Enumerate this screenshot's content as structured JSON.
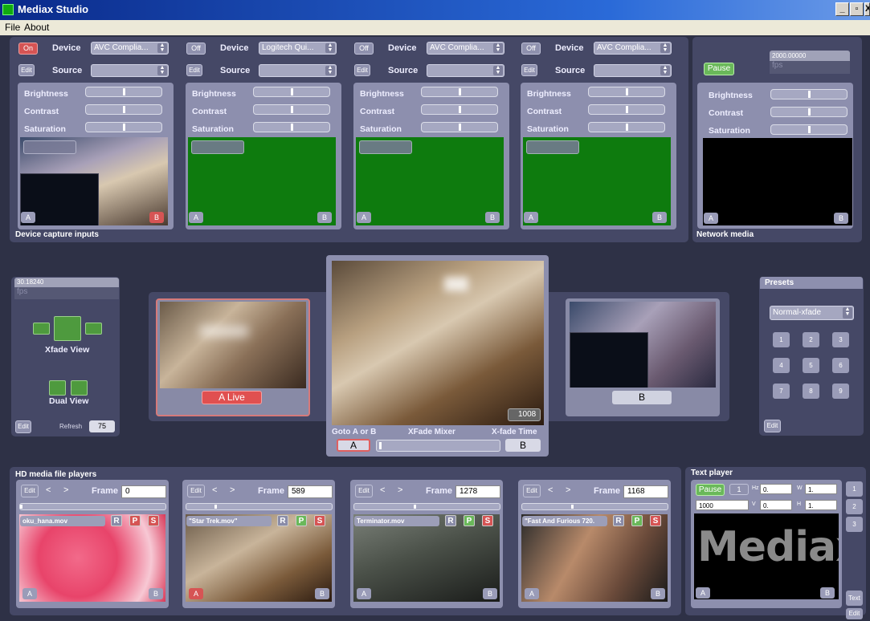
{
  "app": {
    "title": "Mediax Studio",
    "menu": [
      "File",
      "About"
    ],
    "win_min": "_",
    "win_max": "▫",
    "win_close": "X"
  },
  "device_inputs": {
    "caption": "Device capture inputs",
    "device_label": "Device",
    "source_label": "Source",
    "edit_label": "Edit",
    "brightness": "Brightness",
    "contrast": "Contrast",
    "saturation": "Saturation",
    "a": "A",
    "b": "B",
    "channels": [
      {
        "state": "On",
        "device": "AVC Complia...",
        "source": ""
      },
      {
        "state": "Off",
        "device": "Logitech Qui...",
        "source": ""
      },
      {
        "state": "Off",
        "device": "AVC Complia...",
        "source": ""
      },
      {
        "state": "Off",
        "device": "AVC Complia...",
        "source": ""
      }
    ]
  },
  "network": {
    "caption": "Network media",
    "pause": "Pause",
    "fps_value": "2000.00000",
    "fps_label": "fps",
    "brightness": "Brightness",
    "contrast": "Contrast",
    "saturation": "Saturation",
    "a": "A",
    "b": "B"
  },
  "view": {
    "fps_value": "30.18240",
    "fps_label": "fps",
    "xfade_view": "Xfade View",
    "dual_view": "Dual View",
    "edit": "Edit",
    "refresh_label": "Refresh",
    "refresh_value": "75"
  },
  "mixer": {
    "a_live": "A Live",
    "b_label": "B",
    "time_value": "1008",
    "goto": "Goto A or B",
    "title": "XFade Mixer",
    "xfade_time": "X-fade Time",
    "a_btn": "A",
    "b_btn": "B"
  },
  "presets": {
    "title": "Presets",
    "selected": "Normal-xfade",
    "buttons": [
      "1",
      "2",
      "3",
      "4",
      "5",
      "6",
      "7",
      "8",
      "9"
    ],
    "edit": "Edit"
  },
  "players": {
    "caption": "HD media file players",
    "edit": "Edit",
    "prev": "<",
    "next": ">",
    "frame_label": "Frame",
    "r": "R",
    "p": "P",
    "s": "S",
    "a": "A",
    "b": "B",
    "items": [
      {
        "frame": "0",
        "file": "oku_hana.mov",
        "progress": 0.0
      },
      {
        "frame": "589",
        "file": "\"Star Trek.mov\"",
        "progress": 0.2
      },
      {
        "frame": "1278",
        "file": "Terminator.mov",
        "progress": 0.42
      },
      {
        "frame": "1168",
        "file": "\"Fast And Furious 720.",
        "progress": 0.35
      }
    ]
  },
  "text_player": {
    "caption": "Text player",
    "pause": "Pause",
    "one": "1",
    "hz": "Hz",
    "hz_value": "0.",
    "w": "W",
    "w_value": "1.",
    "thousand": "1000",
    "v": "V",
    "v_value": "0.",
    "h": "H",
    "h_value": "1.",
    "display": "Mediax",
    "side_buttons": [
      "1",
      "2",
      "3"
    ],
    "text_btn": "Text",
    "edit": "Edit",
    "a": "A",
    "b": "B"
  }
}
